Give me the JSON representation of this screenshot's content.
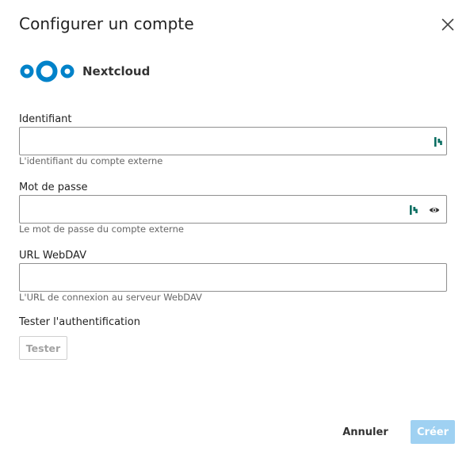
{
  "dialog": {
    "title": "Configurer un compte",
    "close_icon": "close-icon"
  },
  "provider": {
    "name": "Nextcloud",
    "logo_icon": "nextcloud-logo",
    "logo_color": "#0082c9"
  },
  "fields": {
    "identifier": {
      "label": "Identifiant",
      "value": "",
      "hint": "L'identifiant du compte externe",
      "icons": [
        "password-manager-icon"
      ]
    },
    "password": {
      "label": "Mot de passe",
      "value": "",
      "hint": "Le mot de passe du compte externe",
      "icons": [
        "password-manager-icon",
        "eye-icon"
      ]
    },
    "webdav_url": {
      "label": "URL WebDAV",
      "value": "",
      "hint": "L'URL de connexion au serveur WebDAV"
    }
  },
  "test_section": {
    "label": "Tester l'authentification",
    "button_label": "Tester"
  },
  "footer": {
    "cancel_label": "Annuler",
    "create_label": "Créer",
    "create_color": "#9fd1f2"
  }
}
